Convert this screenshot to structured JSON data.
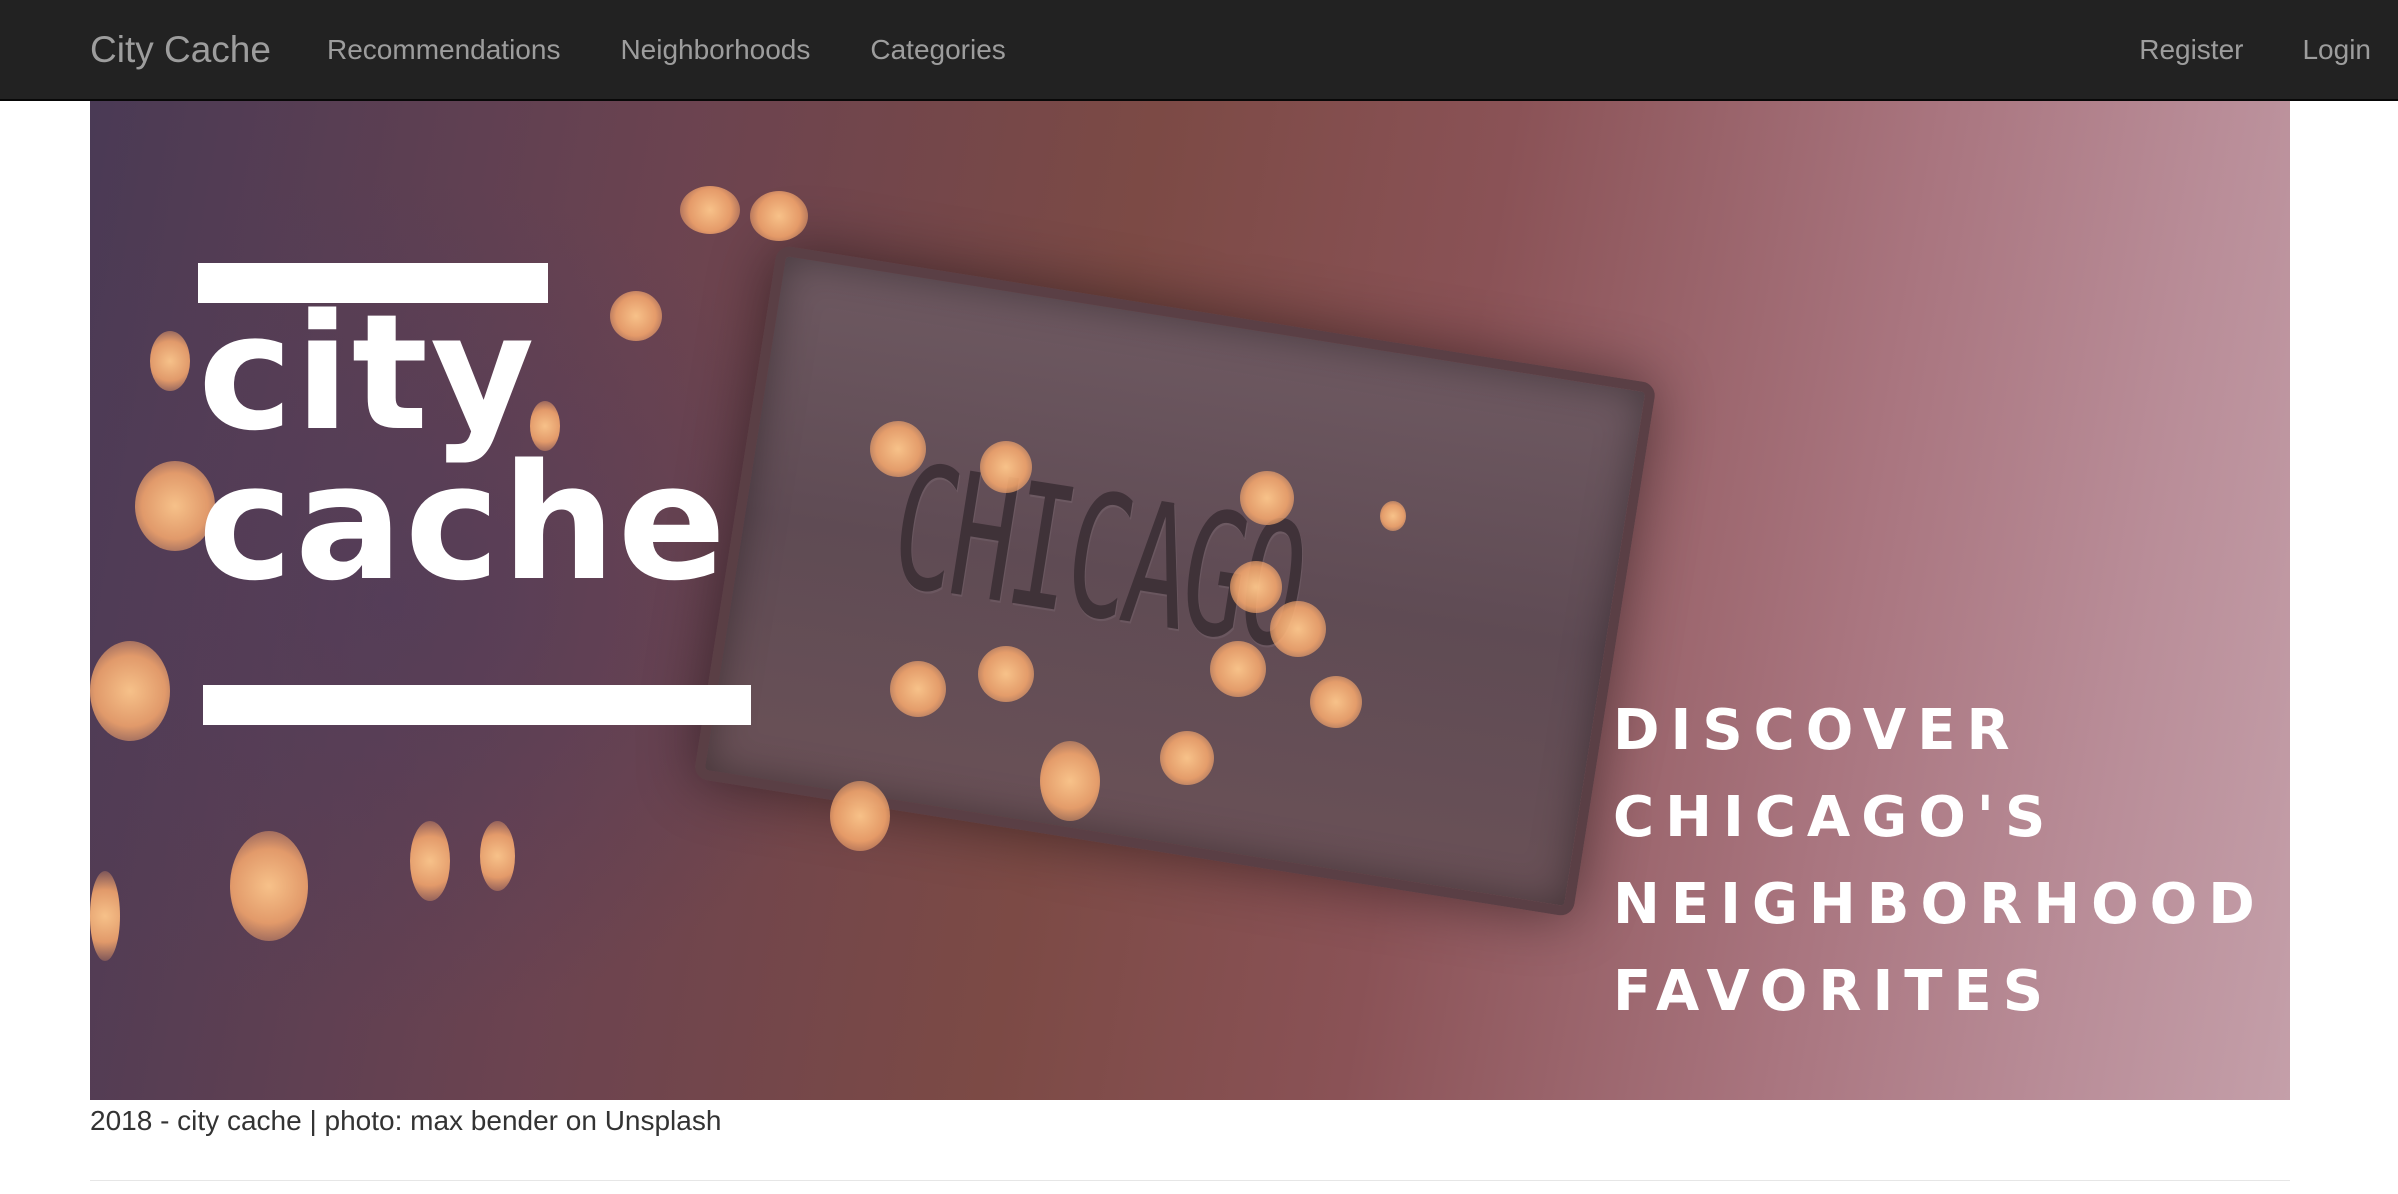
{
  "navbar": {
    "brand": "City Cache",
    "left_links": [
      "Recommendations",
      "Neighborhoods",
      "Categories"
    ],
    "right_links": [
      "Register",
      "Login"
    ]
  },
  "hero": {
    "logo_line1": "city",
    "logo_line2": "cache",
    "plate_text": "CHICAGO",
    "tagline": [
      "DISCOVER",
      "CHICAGO'S",
      "NEIGHBORHOOD",
      "FAVORITES"
    ]
  },
  "footer": {
    "caption": "2018 - city cache | photo: max bender on Unsplash"
  },
  "colors": {
    "navbar_bg": "#222222",
    "nav_text": "#9d9d9d",
    "caption_text": "#333333"
  }
}
